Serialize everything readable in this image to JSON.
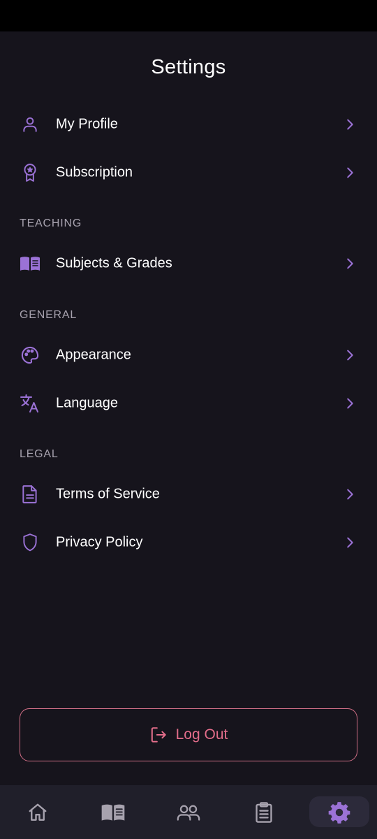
{
  "header": {
    "title": "Settings"
  },
  "account": {
    "items": [
      {
        "label": "My Profile",
        "icon": "user-icon"
      },
      {
        "label": "Subscription",
        "icon": "award-icon"
      }
    ]
  },
  "teaching": {
    "title": "TEACHING",
    "items": [
      {
        "label": "Subjects & Grades",
        "icon": "book-icon"
      }
    ]
  },
  "general": {
    "title": "GENERAL",
    "items": [
      {
        "label": "Appearance",
        "icon": "palette-icon"
      },
      {
        "label": "Language",
        "icon": "translate-icon"
      }
    ]
  },
  "legal": {
    "title": "LEGAL",
    "items": [
      {
        "label": "Terms of Service",
        "icon": "document-icon"
      },
      {
        "label": "Privacy Policy",
        "icon": "shield-icon"
      }
    ]
  },
  "logout": {
    "label": "Log Out",
    "icon": "logout-icon"
  },
  "nav": {
    "items": [
      {
        "icon": "home-icon",
        "active": false
      },
      {
        "icon": "book-icon",
        "active": false
      },
      {
        "icon": "users-icon",
        "active": false
      },
      {
        "icon": "clipboard-icon",
        "active": false
      },
      {
        "icon": "gear-icon",
        "active": true
      }
    ]
  },
  "colors": {
    "background": "#16141c",
    "accent": "#9b72d6",
    "muted": "#a7a2ae",
    "danger": "#e26d8a",
    "nav_background": "#201f2a"
  }
}
